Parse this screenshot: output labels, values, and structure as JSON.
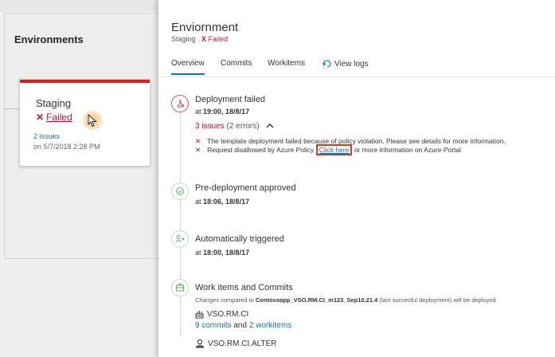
{
  "background": {
    "title": "Environments",
    "stage": {
      "name": "Staging",
      "status": "Failed",
      "issues_link": "2 issues",
      "date": "on 5/7/2018 2:28 PM"
    }
  },
  "panel": {
    "title": "Enviornment",
    "subtitle_env": "Staging .",
    "subtitle_status": "Failed",
    "tabs": [
      "Overview",
      "Commits",
      "Workitems",
      "View logs"
    ],
    "active_tab": "Overview",
    "sections": {
      "deployment_failed": {
        "title": "Deployment failed",
        "time_prefix": "at",
        "time": "19:00, 18/8/17",
        "issues_count": "3 issues",
        "issues_detail": "(2 errors)",
        "issue_1": "The template deployment failed because of policy violation. Please see details for more information.",
        "issue_2_before": "Request disallowed by Azure Policy",
        "issue_2_link": "Click here",
        "issue_2_after": "or more information on Azure Portal"
      },
      "pre_deployment": {
        "title": "Pre-deployment approved",
        "time_prefix": "at",
        "time": "18:06, 18/8/17"
      },
      "triggered": {
        "title": "Automatically triggered",
        "time_prefix": "at",
        "time": "18:00, 18/8/17"
      },
      "work_items": {
        "title": "Work items and Commits",
        "changes_prefix": "Changes compared to",
        "changes_build": "Contosoapp_VSO.RM.CI_m123_Sep10.21.4",
        "changes_suffix": "(last succesful deployment) will be deployed",
        "artifact_1": "VSO.RM.CI",
        "commits_link": "9 commits",
        "and_text": "and",
        "workitems_link": "2 workitems",
        "artifact_2": "VSO.RM.CI.ALTER"
      }
    }
  },
  "colors": {
    "error": "#c8102e",
    "accent": "#0078d4",
    "link": "#106ebe",
    "highlight_box": "#d9391f"
  },
  "icons": [
    "error-x-icon",
    "chevron-up-icon",
    "view-logs-icon",
    "deployment-failed-icon",
    "approval-icon",
    "trigger-icon",
    "work-items-icon",
    "build-artifact-icon",
    "artifact-alter-icon",
    "mouse-cursor-icon"
  ]
}
